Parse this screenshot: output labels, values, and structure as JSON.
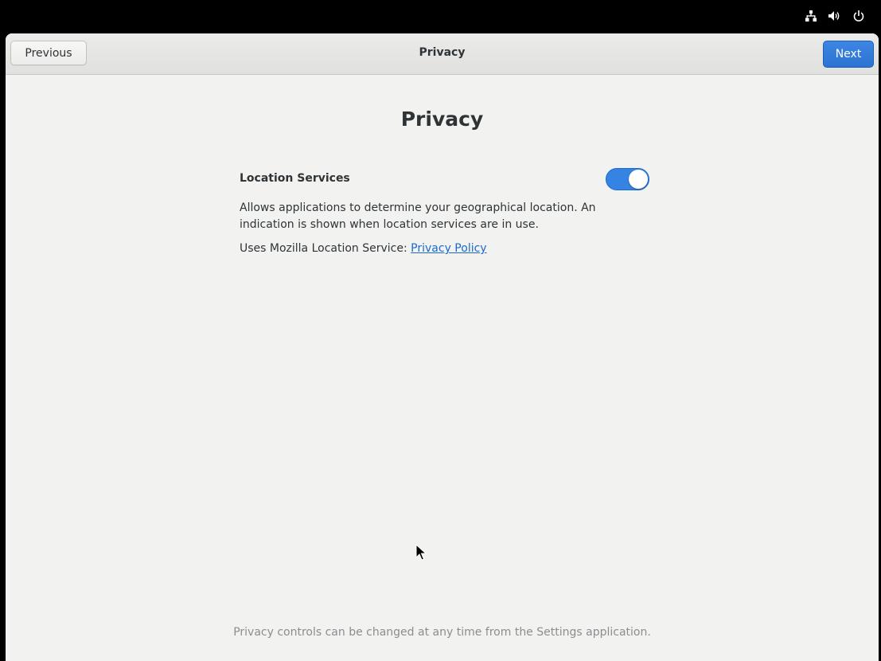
{
  "system_tray": {
    "icons": [
      "network-icon",
      "volume-icon",
      "power-icon"
    ]
  },
  "headerbar": {
    "title": "Privacy",
    "previous_label": "Previous",
    "next_label": "Next"
  },
  "main": {
    "title": "Privacy",
    "location_services": {
      "label": "Location Services",
      "enabled": true,
      "description": "Allows applications to determine your geographical location. An indication is shown when location services are in use.",
      "service_prefix": "Uses Mozilla Location Service: ",
      "policy_link": "Privacy Policy"
    },
    "footer": "Privacy controls can be changed at any time from the Settings application."
  },
  "colors": {
    "accent": "#3584e4",
    "link": "#1b6acb",
    "background": "#f2f2f0"
  }
}
